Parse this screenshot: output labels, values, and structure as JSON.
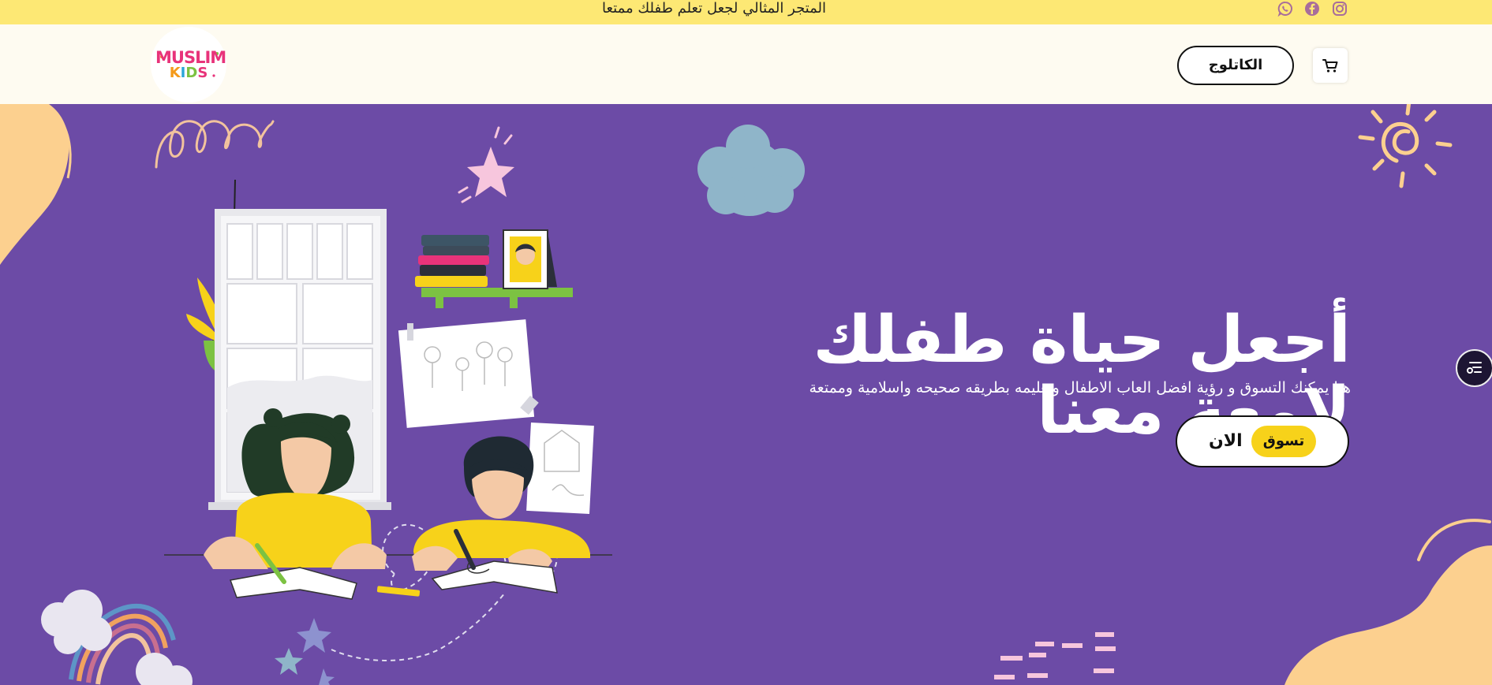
{
  "topbar": {
    "tagline": "المتجر المثالي لجعل تعلم طفلك ممتعا",
    "social_icons": [
      "instagram-icon",
      "facebook-icon",
      "whatsapp-icon"
    ]
  },
  "header": {
    "logo": {
      "line1": "MUSLIM",
      "line2": "KIDS"
    },
    "catalog_label": "الكاتلوج",
    "cart_icon": "cart-icon"
  },
  "hero": {
    "headline_line1": "أجعل حياة طفلك",
    "headline_line2": "لامعة معنا",
    "subtext": "هنا يمكنك التسوق و رؤية افضل العاب الاطفال وتعليمه بطريقه صحيحه واسلامية وممتعة",
    "cta_highlight": "تسوق",
    "cta_rest": "الان"
  },
  "widget": {
    "icon": "menu-list-icon"
  },
  "colors": {
    "topbar": "#fde874",
    "header": "#fefbf1",
    "hero_bg": "#6c4ba6",
    "accent_yellow": "#f7d21a",
    "blob_peach": "#fcd08f",
    "cloud_blue": "#8fb5c9"
  }
}
